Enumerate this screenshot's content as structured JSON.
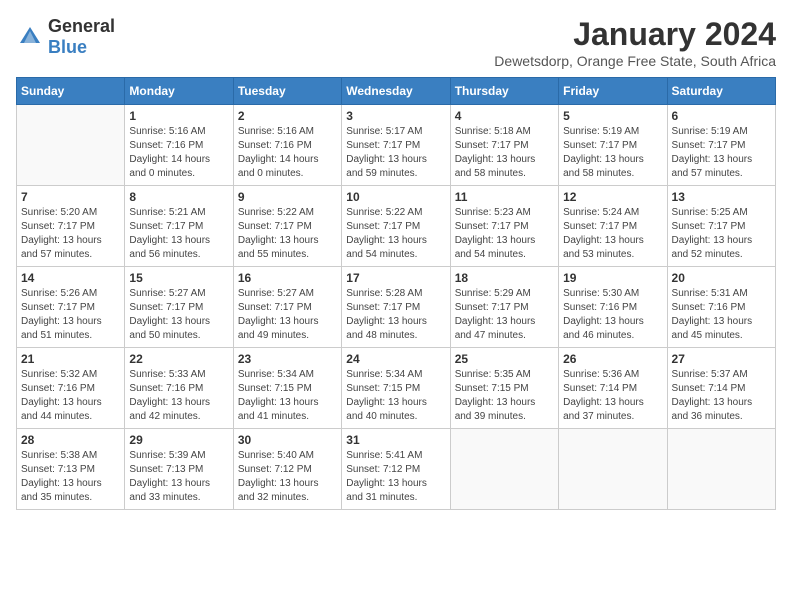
{
  "logo": {
    "general": "General",
    "blue": "Blue"
  },
  "title": "January 2024",
  "subtitle": "Dewetsdorp, Orange Free State, South Africa",
  "headers": [
    "Sunday",
    "Monday",
    "Tuesday",
    "Wednesday",
    "Thursday",
    "Friday",
    "Saturday"
  ],
  "weeks": [
    [
      {
        "day": "",
        "sunrise": "",
        "sunset": "",
        "daylight": ""
      },
      {
        "day": "1",
        "sunrise": "Sunrise: 5:16 AM",
        "sunset": "Sunset: 7:16 PM",
        "daylight": "Daylight: 14 hours and 0 minutes."
      },
      {
        "day": "2",
        "sunrise": "Sunrise: 5:16 AM",
        "sunset": "Sunset: 7:16 PM",
        "daylight": "Daylight: 14 hours and 0 minutes."
      },
      {
        "day": "3",
        "sunrise": "Sunrise: 5:17 AM",
        "sunset": "Sunset: 7:17 PM",
        "daylight": "Daylight: 13 hours and 59 minutes."
      },
      {
        "day": "4",
        "sunrise": "Sunrise: 5:18 AM",
        "sunset": "Sunset: 7:17 PM",
        "daylight": "Daylight: 13 hours and 58 minutes."
      },
      {
        "day": "5",
        "sunrise": "Sunrise: 5:19 AM",
        "sunset": "Sunset: 7:17 PM",
        "daylight": "Daylight: 13 hours and 58 minutes."
      },
      {
        "day": "6",
        "sunrise": "Sunrise: 5:19 AM",
        "sunset": "Sunset: 7:17 PM",
        "daylight": "Daylight: 13 hours and 57 minutes."
      }
    ],
    [
      {
        "day": "7",
        "sunrise": "Sunrise: 5:20 AM",
        "sunset": "Sunset: 7:17 PM",
        "daylight": "Daylight: 13 hours and 57 minutes."
      },
      {
        "day": "8",
        "sunrise": "Sunrise: 5:21 AM",
        "sunset": "Sunset: 7:17 PM",
        "daylight": "Daylight: 13 hours and 56 minutes."
      },
      {
        "day": "9",
        "sunrise": "Sunrise: 5:22 AM",
        "sunset": "Sunset: 7:17 PM",
        "daylight": "Daylight: 13 hours and 55 minutes."
      },
      {
        "day": "10",
        "sunrise": "Sunrise: 5:22 AM",
        "sunset": "Sunset: 7:17 PM",
        "daylight": "Daylight: 13 hours and 54 minutes."
      },
      {
        "day": "11",
        "sunrise": "Sunrise: 5:23 AM",
        "sunset": "Sunset: 7:17 PM",
        "daylight": "Daylight: 13 hours and 54 minutes."
      },
      {
        "day": "12",
        "sunrise": "Sunrise: 5:24 AM",
        "sunset": "Sunset: 7:17 PM",
        "daylight": "Daylight: 13 hours and 53 minutes."
      },
      {
        "day": "13",
        "sunrise": "Sunrise: 5:25 AM",
        "sunset": "Sunset: 7:17 PM",
        "daylight": "Daylight: 13 hours and 52 minutes."
      }
    ],
    [
      {
        "day": "14",
        "sunrise": "Sunrise: 5:26 AM",
        "sunset": "Sunset: 7:17 PM",
        "daylight": "Daylight: 13 hours and 51 minutes."
      },
      {
        "day": "15",
        "sunrise": "Sunrise: 5:27 AM",
        "sunset": "Sunset: 7:17 PM",
        "daylight": "Daylight: 13 hours and 50 minutes."
      },
      {
        "day": "16",
        "sunrise": "Sunrise: 5:27 AM",
        "sunset": "Sunset: 7:17 PM",
        "daylight": "Daylight: 13 hours and 49 minutes."
      },
      {
        "day": "17",
        "sunrise": "Sunrise: 5:28 AM",
        "sunset": "Sunset: 7:17 PM",
        "daylight": "Daylight: 13 hours and 48 minutes."
      },
      {
        "day": "18",
        "sunrise": "Sunrise: 5:29 AM",
        "sunset": "Sunset: 7:17 PM",
        "daylight": "Daylight: 13 hours and 47 minutes."
      },
      {
        "day": "19",
        "sunrise": "Sunrise: 5:30 AM",
        "sunset": "Sunset: 7:16 PM",
        "daylight": "Daylight: 13 hours and 46 minutes."
      },
      {
        "day": "20",
        "sunrise": "Sunrise: 5:31 AM",
        "sunset": "Sunset: 7:16 PM",
        "daylight": "Daylight: 13 hours and 45 minutes."
      }
    ],
    [
      {
        "day": "21",
        "sunrise": "Sunrise: 5:32 AM",
        "sunset": "Sunset: 7:16 PM",
        "daylight": "Daylight: 13 hours and 44 minutes."
      },
      {
        "day": "22",
        "sunrise": "Sunrise: 5:33 AM",
        "sunset": "Sunset: 7:16 PM",
        "daylight": "Daylight: 13 hours and 42 minutes."
      },
      {
        "day": "23",
        "sunrise": "Sunrise: 5:34 AM",
        "sunset": "Sunset: 7:15 PM",
        "daylight": "Daylight: 13 hours and 41 minutes."
      },
      {
        "day": "24",
        "sunrise": "Sunrise: 5:34 AM",
        "sunset": "Sunset: 7:15 PM",
        "daylight": "Daylight: 13 hours and 40 minutes."
      },
      {
        "day": "25",
        "sunrise": "Sunrise: 5:35 AM",
        "sunset": "Sunset: 7:15 PM",
        "daylight": "Daylight: 13 hours and 39 minutes."
      },
      {
        "day": "26",
        "sunrise": "Sunrise: 5:36 AM",
        "sunset": "Sunset: 7:14 PM",
        "daylight": "Daylight: 13 hours and 37 minutes."
      },
      {
        "day": "27",
        "sunrise": "Sunrise: 5:37 AM",
        "sunset": "Sunset: 7:14 PM",
        "daylight": "Daylight: 13 hours and 36 minutes."
      }
    ],
    [
      {
        "day": "28",
        "sunrise": "Sunrise: 5:38 AM",
        "sunset": "Sunset: 7:13 PM",
        "daylight": "Daylight: 13 hours and 35 minutes."
      },
      {
        "day": "29",
        "sunrise": "Sunrise: 5:39 AM",
        "sunset": "Sunset: 7:13 PM",
        "daylight": "Daylight: 13 hours and 33 minutes."
      },
      {
        "day": "30",
        "sunrise": "Sunrise: 5:40 AM",
        "sunset": "Sunset: 7:12 PM",
        "daylight": "Daylight: 13 hours and 32 minutes."
      },
      {
        "day": "31",
        "sunrise": "Sunrise: 5:41 AM",
        "sunset": "Sunset: 7:12 PM",
        "daylight": "Daylight: 13 hours and 31 minutes."
      },
      {
        "day": "",
        "sunrise": "",
        "sunset": "",
        "daylight": ""
      },
      {
        "day": "",
        "sunrise": "",
        "sunset": "",
        "daylight": ""
      },
      {
        "day": "",
        "sunrise": "",
        "sunset": "",
        "daylight": ""
      }
    ]
  ]
}
